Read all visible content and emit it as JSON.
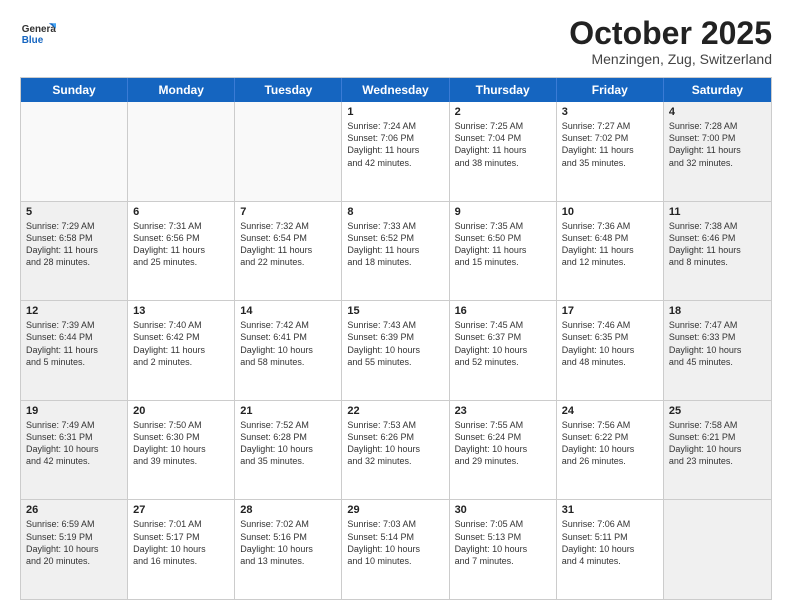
{
  "header": {
    "logo_general": "General",
    "logo_blue": "Blue",
    "month": "October 2025",
    "location": "Menzingen, Zug, Switzerland"
  },
  "days_of_week": [
    "Sunday",
    "Monday",
    "Tuesday",
    "Wednesday",
    "Thursday",
    "Friday",
    "Saturday"
  ],
  "rows": [
    [
      {
        "day": "",
        "info": "",
        "empty": true
      },
      {
        "day": "",
        "info": "",
        "empty": true
      },
      {
        "day": "",
        "info": "",
        "empty": true
      },
      {
        "day": "1",
        "info": "Sunrise: 7:24 AM\nSunset: 7:06 PM\nDaylight: 11 hours\nand 42 minutes.",
        "empty": false
      },
      {
        "day": "2",
        "info": "Sunrise: 7:25 AM\nSunset: 7:04 PM\nDaylight: 11 hours\nand 38 minutes.",
        "empty": false
      },
      {
        "day": "3",
        "info": "Sunrise: 7:27 AM\nSunset: 7:02 PM\nDaylight: 11 hours\nand 35 minutes.",
        "empty": false
      },
      {
        "day": "4",
        "info": "Sunrise: 7:28 AM\nSunset: 7:00 PM\nDaylight: 11 hours\nand 32 minutes.",
        "empty": false,
        "shaded": true
      }
    ],
    [
      {
        "day": "5",
        "info": "Sunrise: 7:29 AM\nSunset: 6:58 PM\nDaylight: 11 hours\nand 28 minutes.",
        "empty": false,
        "shaded": true
      },
      {
        "day": "6",
        "info": "Sunrise: 7:31 AM\nSunset: 6:56 PM\nDaylight: 11 hours\nand 25 minutes.",
        "empty": false
      },
      {
        "day": "7",
        "info": "Sunrise: 7:32 AM\nSunset: 6:54 PM\nDaylight: 11 hours\nand 22 minutes.",
        "empty": false
      },
      {
        "day": "8",
        "info": "Sunrise: 7:33 AM\nSunset: 6:52 PM\nDaylight: 11 hours\nand 18 minutes.",
        "empty": false
      },
      {
        "day": "9",
        "info": "Sunrise: 7:35 AM\nSunset: 6:50 PM\nDaylight: 11 hours\nand 15 minutes.",
        "empty": false
      },
      {
        "day": "10",
        "info": "Sunrise: 7:36 AM\nSunset: 6:48 PM\nDaylight: 11 hours\nand 12 minutes.",
        "empty": false
      },
      {
        "day": "11",
        "info": "Sunrise: 7:38 AM\nSunset: 6:46 PM\nDaylight: 11 hours\nand 8 minutes.",
        "empty": false,
        "shaded": true
      }
    ],
    [
      {
        "day": "12",
        "info": "Sunrise: 7:39 AM\nSunset: 6:44 PM\nDaylight: 11 hours\nand 5 minutes.",
        "empty": false,
        "shaded": true
      },
      {
        "day": "13",
        "info": "Sunrise: 7:40 AM\nSunset: 6:42 PM\nDaylight: 11 hours\nand 2 minutes.",
        "empty": false
      },
      {
        "day": "14",
        "info": "Sunrise: 7:42 AM\nSunset: 6:41 PM\nDaylight: 10 hours\nand 58 minutes.",
        "empty": false
      },
      {
        "day": "15",
        "info": "Sunrise: 7:43 AM\nSunset: 6:39 PM\nDaylight: 10 hours\nand 55 minutes.",
        "empty": false
      },
      {
        "day": "16",
        "info": "Sunrise: 7:45 AM\nSunset: 6:37 PM\nDaylight: 10 hours\nand 52 minutes.",
        "empty": false
      },
      {
        "day": "17",
        "info": "Sunrise: 7:46 AM\nSunset: 6:35 PM\nDaylight: 10 hours\nand 48 minutes.",
        "empty": false
      },
      {
        "day": "18",
        "info": "Sunrise: 7:47 AM\nSunset: 6:33 PM\nDaylight: 10 hours\nand 45 minutes.",
        "empty": false,
        "shaded": true
      }
    ],
    [
      {
        "day": "19",
        "info": "Sunrise: 7:49 AM\nSunset: 6:31 PM\nDaylight: 10 hours\nand 42 minutes.",
        "empty": false,
        "shaded": true
      },
      {
        "day": "20",
        "info": "Sunrise: 7:50 AM\nSunset: 6:30 PM\nDaylight: 10 hours\nand 39 minutes.",
        "empty": false
      },
      {
        "day": "21",
        "info": "Sunrise: 7:52 AM\nSunset: 6:28 PM\nDaylight: 10 hours\nand 35 minutes.",
        "empty": false
      },
      {
        "day": "22",
        "info": "Sunrise: 7:53 AM\nSunset: 6:26 PM\nDaylight: 10 hours\nand 32 minutes.",
        "empty": false
      },
      {
        "day": "23",
        "info": "Sunrise: 7:55 AM\nSunset: 6:24 PM\nDaylight: 10 hours\nand 29 minutes.",
        "empty": false
      },
      {
        "day": "24",
        "info": "Sunrise: 7:56 AM\nSunset: 6:22 PM\nDaylight: 10 hours\nand 26 minutes.",
        "empty": false
      },
      {
        "day": "25",
        "info": "Sunrise: 7:58 AM\nSunset: 6:21 PM\nDaylight: 10 hours\nand 23 minutes.",
        "empty": false,
        "shaded": true
      }
    ],
    [
      {
        "day": "26",
        "info": "Sunrise: 6:59 AM\nSunset: 5:19 PM\nDaylight: 10 hours\nand 20 minutes.",
        "empty": false,
        "shaded": true
      },
      {
        "day": "27",
        "info": "Sunrise: 7:01 AM\nSunset: 5:17 PM\nDaylight: 10 hours\nand 16 minutes.",
        "empty": false
      },
      {
        "day": "28",
        "info": "Sunrise: 7:02 AM\nSunset: 5:16 PM\nDaylight: 10 hours\nand 13 minutes.",
        "empty": false
      },
      {
        "day": "29",
        "info": "Sunrise: 7:03 AM\nSunset: 5:14 PM\nDaylight: 10 hours\nand 10 minutes.",
        "empty": false
      },
      {
        "day": "30",
        "info": "Sunrise: 7:05 AM\nSunset: 5:13 PM\nDaylight: 10 hours\nand 7 minutes.",
        "empty": false
      },
      {
        "day": "31",
        "info": "Sunrise: 7:06 AM\nSunset: 5:11 PM\nDaylight: 10 hours\nand 4 minutes.",
        "empty": false
      },
      {
        "day": "",
        "info": "",
        "empty": true,
        "shaded": true
      }
    ]
  ]
}
